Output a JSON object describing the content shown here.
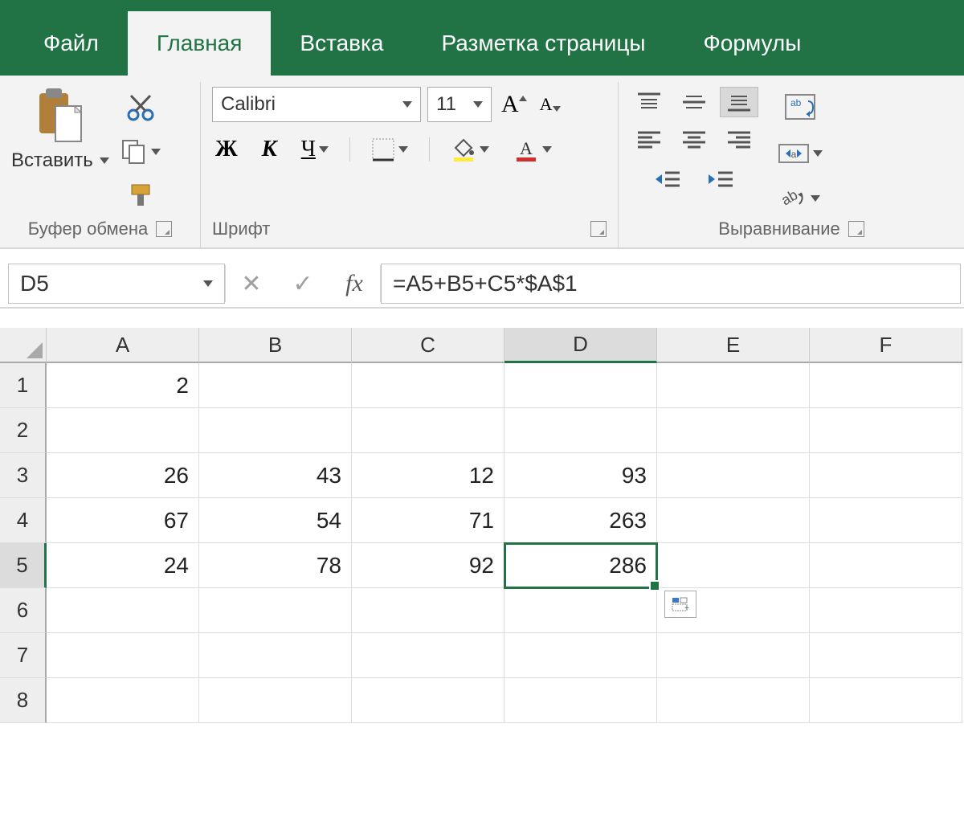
{
  "tabs": {
    "file": "Файл",
    "home": "Главная",
    "insert": "Вставка",
    "layout": "Разметка страницы",
    "formulas": "Формулы"
  },
  "ribbon": {
    "clipboard": {
      "paste": "Вставить",
      "label": "Буфер обмена"
    },
    "font": {
      "name": "Calibri",
      "size": "11",
      "bold": "Ж",
      "italic": "К",
      "underline": "Ч",
      "increase": "A",
      "decrease": "A",
      "label": "Шрифт"
    },
    "align": {
      "label": "Выравнивание"
    }
  },
  "namebox": "D5",
  "fx_label": "fx",
  "formula": "=A5+B5+C5*$A$1",
  "columns": [
    "A",
    "B",
    "C",
    "D",
    "E",
    "F"
  ],
  "rownums": [
    "1",
    "2",
    "3",
    "4",
    "5",
    "6",
    "7",
    "8"
  ],
  "cells": {
    "A1": "2",
    "A3": "26",
    "B3": "43",
    "C3": "12",
    "D3": "93",
    "A4": "67",
    "B4": "54",
    "C4": "71",
    "D4": "263",
    "A5": "24",
    "B5": "78",
    "C5": "92",
    "D5": "286"
  },
  "active_cell": "D5",
  "chart_data": {
    "type": "table",
    "columns": [
      "A",
      "B",
      "C",
      "D"
    ],
    "rows": [
      {
        "row": 1,
        "A": 2
      },
      {
        "row": 3,
        "A": 26,
        "B": 43,
        "C": 12,
        "D": 93
      },
      {
        "row": 4,
        "A": 67,
        "B": 54,
        "C": 71,
        "D": 263
      },
      {
        "row": 5,
        "A": 24,
        "B": 78,
        "C": 92,
        "D": 286
      }
    ],
    "formula_D5": "=A5+B5+C5*$A$1"
  }
}
